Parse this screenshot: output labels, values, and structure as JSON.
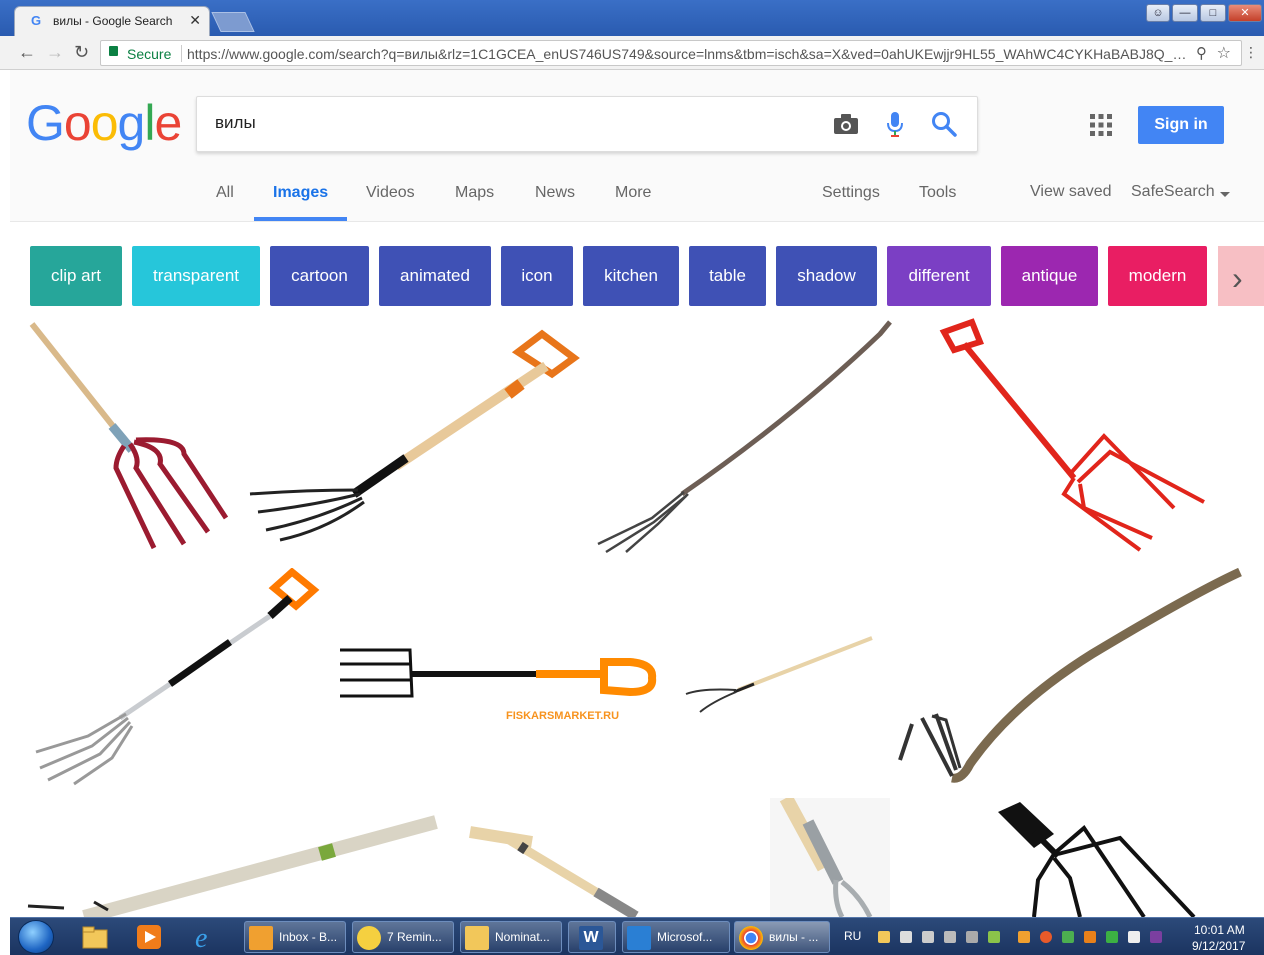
{
  "browser": {
    "tab_title": "вилы - Google Search",
    "tab_favicon": "G",
    "tab_close": "✕",
    "secure_label": "Secure",
    "url": "https://www.google.com/search?q=вилы&rlz=1C1GCEA_enUS746US749&source=lnms&tbm=isch&sa=X&ved=0ahUKEwjjr9HL55_WAhWC4CYKHaBABJ8Q_AUICi..."
  },
  "google": {
    "logo": [
      "G",
      "o",
      "o",
      "g",
      "l",
      "e"
    ],
    "logo_colors": [
      "#4285f4",
      "#ea4335",
      "#fbbc05",
      "#4285f4",
      "#34a853",
      "#ea4335"
    ],
    "query": "вилы",
    "signin_label": "Sign in",
    "tabs": [
      "All",
      "Images",
      "Videos",
      "Maps",
      "News",
      "More"
    ],
    "active_tab": "Images",
    "settings_label": "Settings",
    "tools_label": "Tools",
    "view_saved_label": "View saved",
    "safesearch_label": "SafeSearch",
    "accent_color": "#4285f4"
  },
  "chips": [
    {
      "label": "clip art",
      "color": "#26a69a"
    },
    {
      "label": "transparent",
      "color": "#26c6da"
    },
    {
      "label": "cartoon",
      "color": "#3f51b5"
    },
    {
      "label": "animated",
      "color": "#3f51b5"
    },
    {
      "label": "icon",
      "color": "#3f51b5"
    },
    {
      "label": "kitchen",
      "color": "#3f51b5"
    },
    {
      "label": "table",
      "color": "#3f51b5"
    },
    {
      "label": "shadow",
      "color": "#3f51b5"
    },
    {
      "label": "different",
      "color": "#7b3fc4"
    },
    {
      "label": "antique",
      "color": "#9c27b0"
    },
    {
      "label": "modern",
      "color": "#e91e63"
    }
  ],
  "results": {
    "watermark": "FISKARSMARKET.RU",
    "images": [
      "pitchfork-red-tines",
      "pitchfork-wood-d-handle",
      "pitchfork-long-wooden",
      "pitchfork-red-d-handle",
      "fork-fiskars-black-orange",
      "fork-fiskars-horizontal",
      "fork-small-light-handle",
      "pitchfork-rustic-branch",
      "fork-long-pale-handle",
      "fork-t-handle",
      "fork-steel-vertical",
      "fork-black-tines"
    ]
  },
  "taskbar": {
    "items": [
      {
        "label": "Inbox - B...",
        "icon": "outlook-icon",
        "color": "#f0a030"
      },
      {
        "label": "7 Remin...",
        "icon": "reminder-bell-icon",
        "color": "#f5d040"
      },
      {
        "label": "Nominat...",
        "icon": "mail-envelope-icon",
        "color": "#f2c75a"
      },
      {
        "label": "",
        "icon": "word-icon",
        "color": "#2b5797"
      },
      {
        "label": "Microsof...",
        "icon": "lync-icon",
        "color": "#2a7fd4"
      },
      {
        "label": "вилы - ...",
        "icon": "chrome-icon",
        "color": "#4285f4"
      }
    ],
    "word_glyph": "W",
    "language": "RU",
    "clock_time": "10:01 AM",
    "clock_date": "9/12/2017"
  }
}
